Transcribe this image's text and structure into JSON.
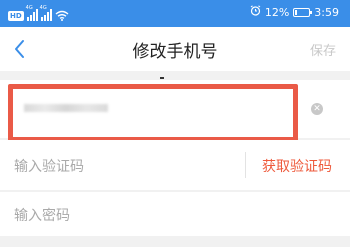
{
  "status_bar": {
    "network": "HD",
    "signal1_tag": "4G",
    "signal2_tag": "4G",
    "battery": "12%",
    "battery_level": 0.12,
    "time": "3:59"
  },
  "nav": {
    "title": "修改手机号",
    "save_label": "保存"
  },
  "form": {
    "verification_placeholder": "输入验证码",
    "get_code_label": "获取验证码",
    "password_placeholder": "输入密码"
  },
  "colors": {
    "status_bar": "#3a8ee8",
    "accent": "#ee5a3c",
    "highlight": "#ea5a47"
  }
}
